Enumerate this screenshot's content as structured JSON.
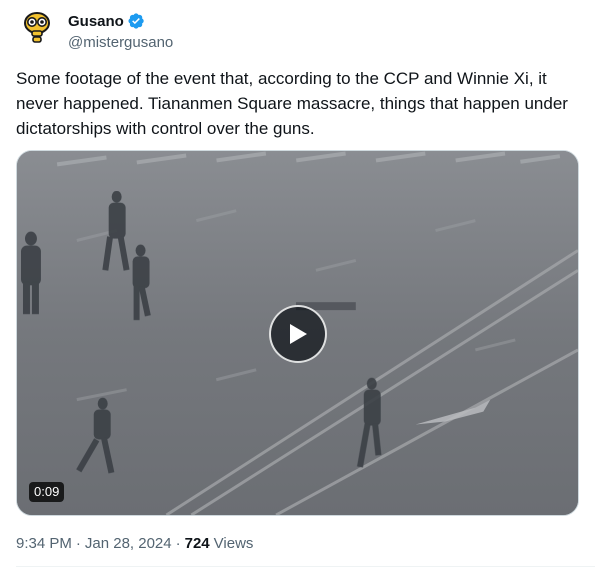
{
  "author": {
    "display_name": "Gusano",
    "handle": "@mistergusano",
    "verified": true,
    "verified_badge_color": "#1d9bf0",
    "avatar_icon": "worm-face-avatar",
    "avatar_color": "#f2c230"
  },
  "tweet": {
    "text": "Some footage of the event that, according to the CCP and Winnie Xi, it never happened. Tiananmen Square massacre, things that happen under dictatorships with control over the guns."
  },
  "media": {
    "type": "video",
    "duration": "0:09",
    "play_icon": "play-icon"
  },
  "meta": {
    "time": "9:34 PM",
    "separator": "·",
    "date": "Jan 28, 2024",
    "views_count": "724",
    "views_label": "Views"
  }
}
